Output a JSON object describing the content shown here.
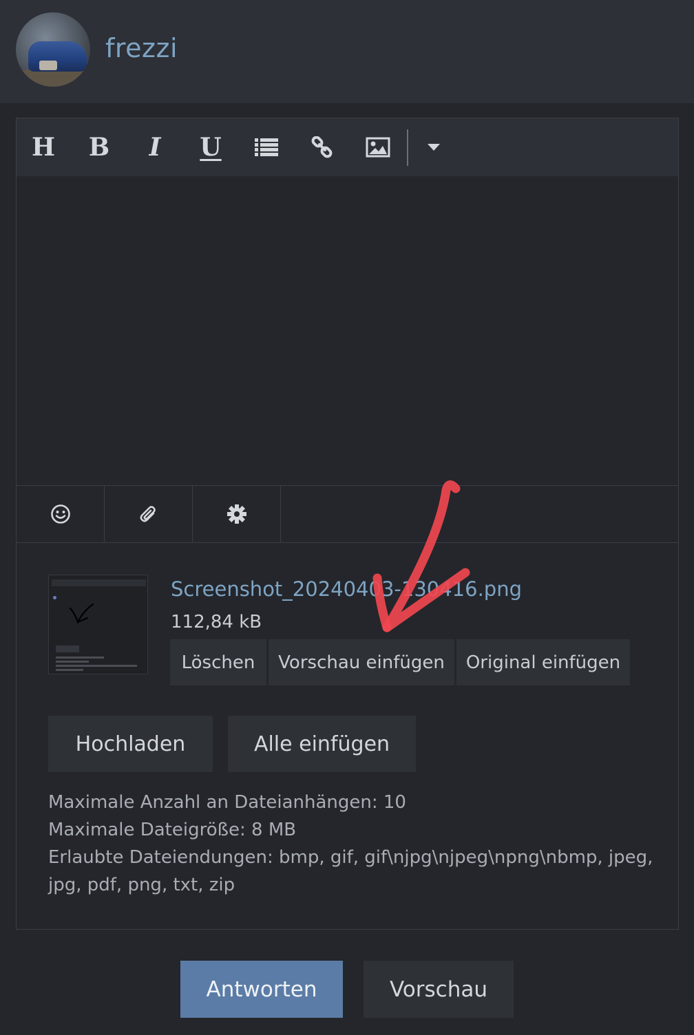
{
  "user": {
    "name": "frezzi"
  },
  "toolbar": {
    "buttons": [
      {
        "label": "H",
        "icon": "heading-icon"
      },
      {
        "label": "B",
        "icon": "bold-icon"
      },
      {
        "label": "I",
        "icon": "italic-icon"
      },
      {
        "label": "U",
        "icon": "underline-icon"
      },
      {
        "icon": "list-icon"
      },
      {
        "icon": "link-icon"
      },
      {
        "icon": "image-icon"
      },
      {
        "icon": "dropdown-caret-icon"
      }
    ]
  },
  "bottom_toolbar": {
    "icons": [
      "smiley-icon",
      "paperclip-icon",
      "gear-icon"
    ]
  },
  "attachment": {
    "file_name": "Screenshot_20240403-130416.png",
    "file_size": "112,84 kB",
    "actions": {
      "delete": "Löschen",
      "insert_preview": "Vorschau einfügen",
      "insert_original": "Original einfügen"
    }
  },
  "upload": {
    "upload_label": "Hochladen",
    "insert_all_label": "Alle einfügen"
  },
  "info": {
    "max_attachments": "Maximale Anzahl an Dateianhängen: 10",
    "max_size": "Maximale Dateigröße: 8 MB",
    "allowed_ext": "Erlaubte Dateiendungen: bmp, gif, gif\\njpg\\njpeg\\npng\\nbmp, jpeg, jpg, pdf, png, txt, zip"
  },
  "submit": {
    "reply_label": "Antworten",
    "preview_label": "Vorschau"
  },
  "colors": {
    "accent": "#5b7ca6",
    "link": "#7ea4c4",
    "annotation_arrow": "#f0474f"
  }
}
